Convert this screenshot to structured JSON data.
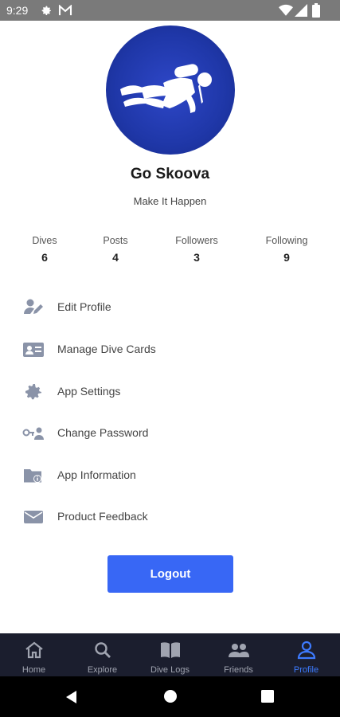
{
  "status_bar": {
    "time": "9:29",
    "icons": [
      "gear-icon",
      "gmail-icon",
      "wifi-icon",
      "signal-icon",
      "battery-icon"
    ]
  },
  "profile": {
    "avatar_icon": "scuba-diver-icon",
    "name": "Go Skoova",
    "motto": "Make It Happen"
  },
  "stats": [
    {
      "label": "Dives",
      "value": "6"
    },
    {
      "label": "Posts",
      "value": "4"
    },
    {
      "label": "Followers",
      "value": "3"
    },
    {
      "label": "Following",
      "value": "9"
    }
  ],
  "menu": [
    {
      "label": "Edit Profile",
      "icon": "edit-profile-icon"
    },
    {
      "label": "Manage Dive Cards",
      "icon": "id-card-icon"
    },
    {
      "label": "App Settings",
      "icon": "gear-icon"
    },
    {
      "label": "Change Password",
      "icon": "key-person-icon"
    },
    {
      "label": "App Information",
      "icon": "info-folder-icon"
    },
    {
      "label": "Product Feedback",
      "icon": "envelope-icon"
    }
  ],
  "logout_label": "Logout",
  "bottom_nav": {
    "items": [
      {
        "label": "Home",
        "icon": "home-icon"
      },
      {
        "label": "Explore",
        "icon": "search-icon"
      },
      {
        "label": "Dive Logs",
        "icon": "book-icon"
      },
      {
        "label": "Friends",
        "icon": "friends-icon"
      },
      {
        "label": "Profile",
        "icon": "person-icon"
      }
    ],
    "active": "Profile"
  },
  "colors": {
    "accent": "#3867f5",
    "nav_active": "#3d7bff",
    "nav_bg": "#1b1e2e",
    "avatar_bg": "#1f37a8",
    "icon_gray": "#8a93a8"
  }
}
